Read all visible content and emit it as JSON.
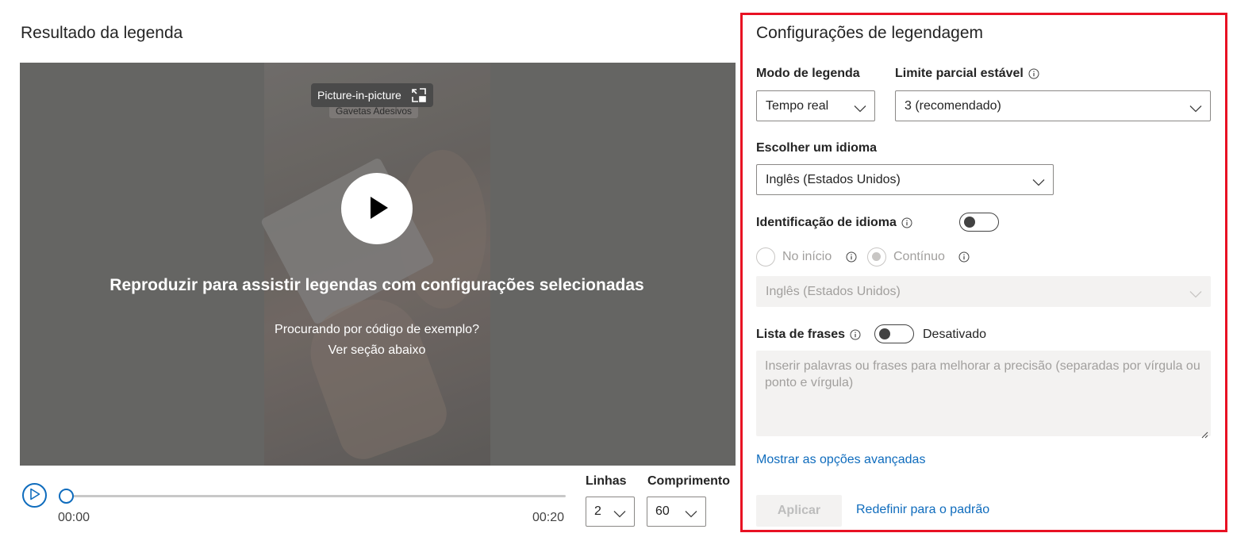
{
  "result": {
    "title": "Resultado da legenda",
    "pip_label": "Picture-in-picture",
    "frame_label": "Gavetas Adesivos",
    "overlay_message": "Reproduzir para assistir legendas com configurações selecionadas",
    "hint_line1": "Procurando por código de exemplo?",
    "hint_line2": "Ver seção abaixo",
    "time_start": "00:00",
    "time_end": "00:20",
    "progress": 0,
    "lines_label": "Linhas",
    "lines_value": "2",
    "length_label": "Comprimento",
    "length_value": "60"
  },
  "settings": {
    "title": "Configurações de legendagem",
    "mode_label": "Modo de legenda",
    "mode_value": "Tempo real",
    "partial_label": "Limite parcial estável",
    "partial_value": "3 (recomendado)",
    "language_label": "Escolher um idioma",
    "language_value": "Inglês (Estados Unidos)",
    "lang_id_label": "Identificação de idioma",
    "lang_id_enabled": false,
    "radio_start": "No início",
    "radio_continuous": "Contínuo",
    "lang_id_select_value": "Inglês (Estados Unidos)",
    "phrase_list_label": "Lista de frases",
    "phrase_list_state": "Desativado",
    "phrase_placeholder": "Inserir palavras ou frases para melhorar a precisão (separadas por vírgula ou ponto e vírgula)",
    "advanced_link": "Mostrar as opções avançadas",
    "apply_label": "Aplicar",
    "reset_link": "Redefinir para o padrão"
  },
  "colors": {
    "accent": "#0f6cbd",
    "highlight_border": "#e81123",
    "video_bg": "#6e6e6c"
  },
  "icons": [
    "picture-in-picture-icon",
    "play-icon",
    "info-icon",
    "chevron-down-icon"
  ]
}
